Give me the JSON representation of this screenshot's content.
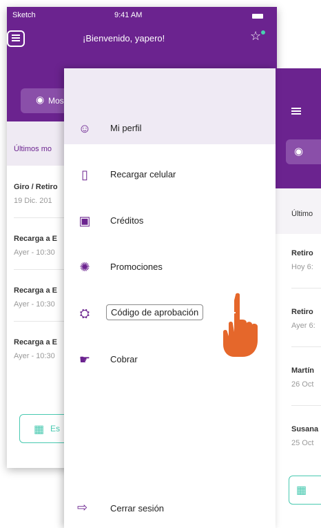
{
  "status_bar": {
    "carrier": "Sketch",
    "time": "9:41 AM"
  },
  "header": {
    "welcome": "¡Bienvenido, yapero!"
  },
  "back_screen": {
    "show_button": "Mos",
    "latest_label": "Últimos mo",
    "items": [
      {
        "title": "Giro / Retiro",
        "subtitle": "19 Dic. 201"
      },
      {
        "title": "Recarga a E",
        "subtitle": "Ayer - 10:30"
      },
      {
        "title": "Recarga a E",
        "subtitle": "Ayer - 10:30"
      },
      {
        "title": "Recarga a E",
        "subtitle": "Ayer - 10:30"
      }
    ],
    "scan_button": "Es"
  },
  "right_screen": {
    "latest_label": "Último",
    "items": [
      {
        "title": "Retiro",
        "subtitle": "Hoy 6:"
      },
      {
        "title": "Retiro",
        "subtitle": "Ayer 6:"
      },
      {
        "title": "Martín",
        "subtitle": "26 Oct"
      },
      {
        "title": "Susana",
        "subtitle": "25 Oct"
      }
    ]
  },
  "drawer": {
    "items": [
      {
        "label": "Mi perfil",
        "icon": "user-icon"
      },
      {
        "label": "Recargar celular",
        "icon": "phone-icon"
      },
      {
        "label": "Créditos",
        "icon": "credits-icon"
      },
      {
        "label": "Promociones",
        "icon": "promo-icon"
      },
      {
        "label": "Código de aprobación",
        "icon": "lock-icon"
      },
      {
        "label": "Cobrar",
        "icon": "charge-icon"
      }
    ],
    "logout": "Cerrar sesión"
  },
  "colors": {
    "primary": "#6b238f",
    "accent": "#48c9b0",
    "pointer": "#e5672b"
  }
}
